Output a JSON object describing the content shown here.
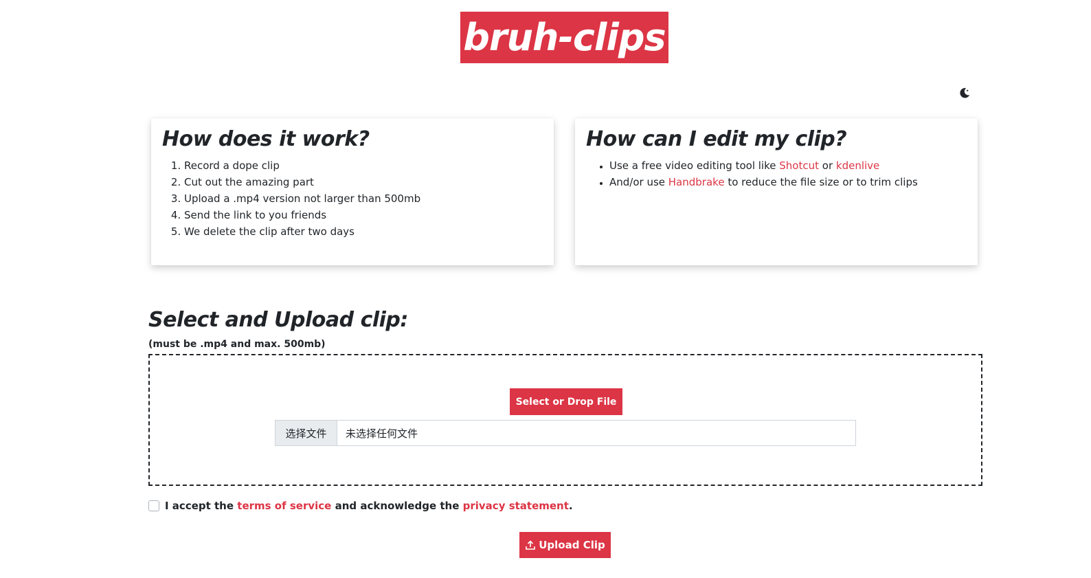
{
  "logo": {
    "text": "bruh-clips"
  },
  "theme_toggle": {
    "icon": "moon-icon"
  },
  "how_it_works": {
    "title": "How does it work?",
    "steps": [
      "Record a dope clip",
      "Cut out the amazing part",
      "Upload a .mp4 version not larger than 500mb",
      "Send the link to you friends",
      "We delete the clip after two days"
    ]
  },
  "edit": {
    "title": "How can I edit my clip?",
    "line1_a": "Use a free video editing tool like ",
    "line1_link1": "Shotcut",
    "line1_b": " or ",
    "line1_link2": "kdenlive",
    "line2_a": "And/or use ",
    "line2_link": "Handbrake",
    "line2_b": " to reduce the file size or to trim clips"
  },
  "upload": {
    "title": "Select and Upload clip:",
    "note": "(must be .mp4 and max. 500mb)",
    "select_button": "Select or Drop File",
    "file_button": "选择文件",
    "file_status": "未选择任何文件"
  },
  "terms": {
    "text_a": "I accept the ",
    "tos_link": "terms of service",
    "text_b": " and acknowledge the ",
    "privacy_link": "privacy statement",
    "text_c": "."
  },
  "upload_button": {
    "label": "Upload Clip",
    "icon": "upload-icon"
  },
  "colors": {
    "accent": "#dc3545",
    "text": "#212529"
  }
}
